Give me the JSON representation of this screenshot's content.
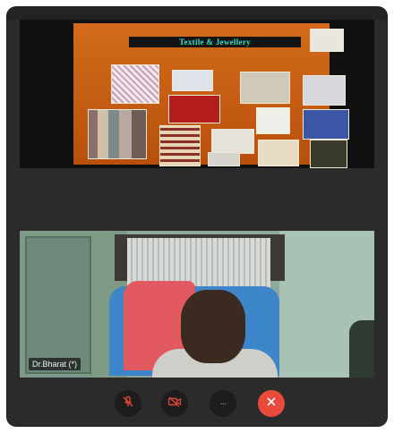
{
  "share": {
    "slide_title": "Textile & Jewellery"
  },
  "participant": {
    "name": "Dr.Bharat",
    "mic_label": "(*)"
  },
  "controls": {
    "mute_icon": "mic-off-icon",
    "video_icon": "camera-off-icon",
    "more_icon": "more-icon",
    "more_label": "···",
    "end_icon": "end-call-icon"
  },
  "colors": {
    "slide_bg": "#c95f12",
    "slide_title_text": "#35e0c4",
    "end_call": "#ea4a3c",
    "icon_red": "#e0463a"
  }
}
